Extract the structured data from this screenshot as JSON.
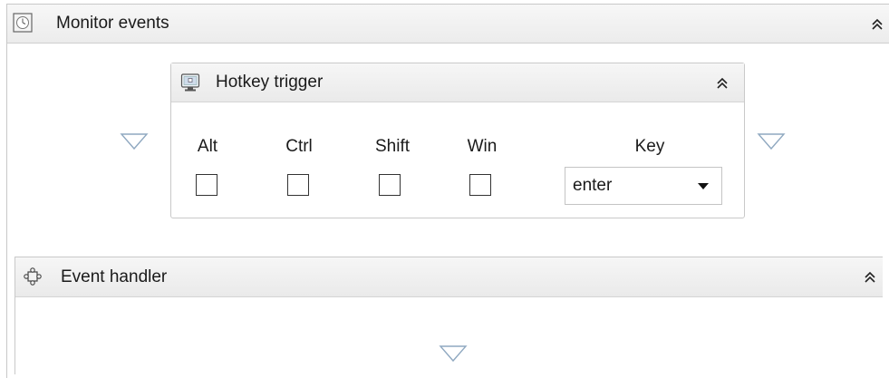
{
  "monitor": {
    "title": "Monitor events",
    "icon": "clock-icon",
    "collapse_icon": "double-chevron-up-icon"
  },
  "trigger": {
    "title": "Hotkey trigger",
    "icon": "monitor-icon",
    "collapse_icon": "double-chevron-up-icon",
    "modifiers": [
      {
        "label": "Alt",
        "checked": false
      },
      {
        "label": "Ctrl",
        "checked": false
      },
      {
        "label": "Shift",
        "checked": false
      },
      {
        "label": "Win",
        "checked": false
      }
    ],
    "key_label": "Key",
    "key_value": "enter"
  },
  "handler": {
    "title": "Event handler",
    "icon": "puzzle-icon",
    "collapse_icon": "double-chevron-up-icon"
  },
  "drop_target_icon": "triangle-down-icon",
  "colors": {
    "border": "#c9c9c9",
    "header_bg": "#f0f0f0",
    "drop_arrow": "#8fa8c0"
  }
}
